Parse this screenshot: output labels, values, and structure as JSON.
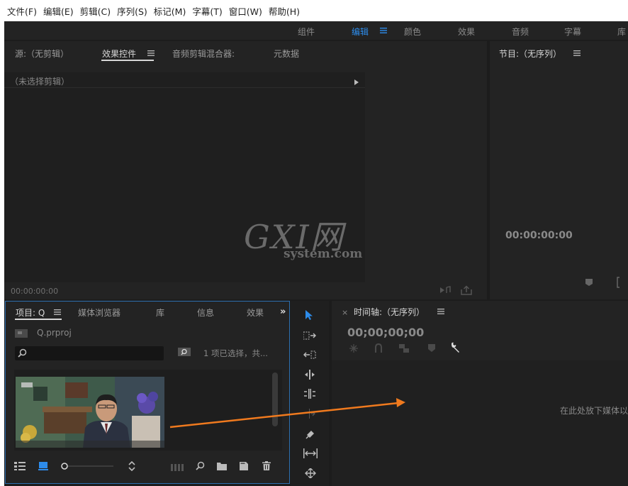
{
  "menu": [
    "文件(F)",
    "编辑(E)",
    "剪辑(C)",
    "序列(S)",
    "标记(M)",
    "字幕(T)",
    "窗口(W)",
    "帮助(H)"
  ],
  "workspaces": {
    "items": [
      "组件",
      "编辑",
      "颜色",
      "效果",
      "音频",
      "字幕",
      "库"
    ],
    "active": "编辑"
  },
  "source_panel": {
    "tabs": [
      "源:（无剪辑）",
      "效果控件",
      "音频剪辑混合器:",
      "元数据"
    ],
    "active_tab": "效果控件",
    "no_clip": "（未选择剪辑）",
    "timecode": "00:00:00:00"
  },
  "program_panel": {
    "title": "节目:（无序列）",
    "timecode": "00:00:00:00"
  },
  "watermark": {
    "logo": "GXI网",
    "sub": "system.com"
  },
  "project_panel": {
    "tabs": [
      "项目: Q",
      "媒体浏览器",
      "库",
      "信息",
      "效果"
    ],
    "active_tab": "项目: Q",
    "file_name": "Q.prproj",
    "selection_info": "1 项已选择，共...",
    "search_placeholder": ""
  },
  "timeline_panel": {
    "title": "时间轴:（无序列）",
    "timecode": "00;00;00;00",
    "drop_hint": "在此处放下媒体以"
  },
  "colors": {
    "accent": "#2d8ceb",
    "panel_bg": "#232323",
    "app_bg": "#1c1c1c",
    "annotation_arrow": "#f07a1e",
    "focus_border": "#2d6fb0"
  }
}
